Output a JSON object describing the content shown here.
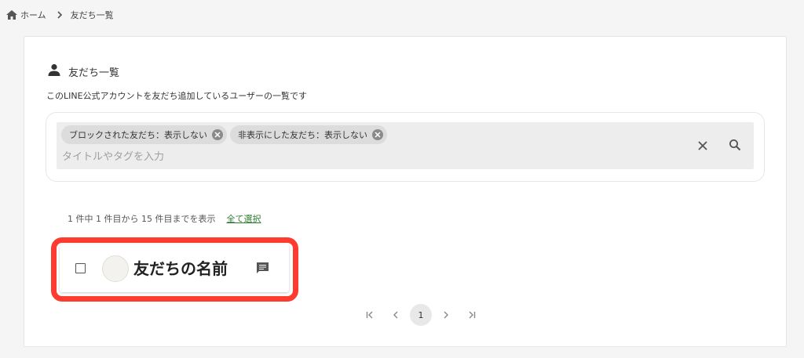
{
  "breadcrumb": {
    "home": "ホーム",
    "current": "友だち一覧"
  },
  "section": {
    "title": "友だち一覧",
    "description": "このLINE公式アカウントを友だち追加しているユーザーの一覧です"
  },
  "search": {
    "chips": [
      {
        "label": "ブロックされた友だち：表示しない"
      },
      {
        "label": "非表示にした友だち：表示しない"
      }
    ],
    "placeholder": "タイトルやタグを入力",
    "value": ""
  },
  "results": {
    "count_text": "1 件中 1 件目から 15 件目までを表示",
    "select_all": "全て選択"
  },
  "friends": [
    {
      "name": "友だちの名前"
    }
  ],
  "pagination": {
    "current": "1"
  },
  "colors": {
    "highlight": "#ff3b30",
    "link": "#2e7d32"
  }
}
